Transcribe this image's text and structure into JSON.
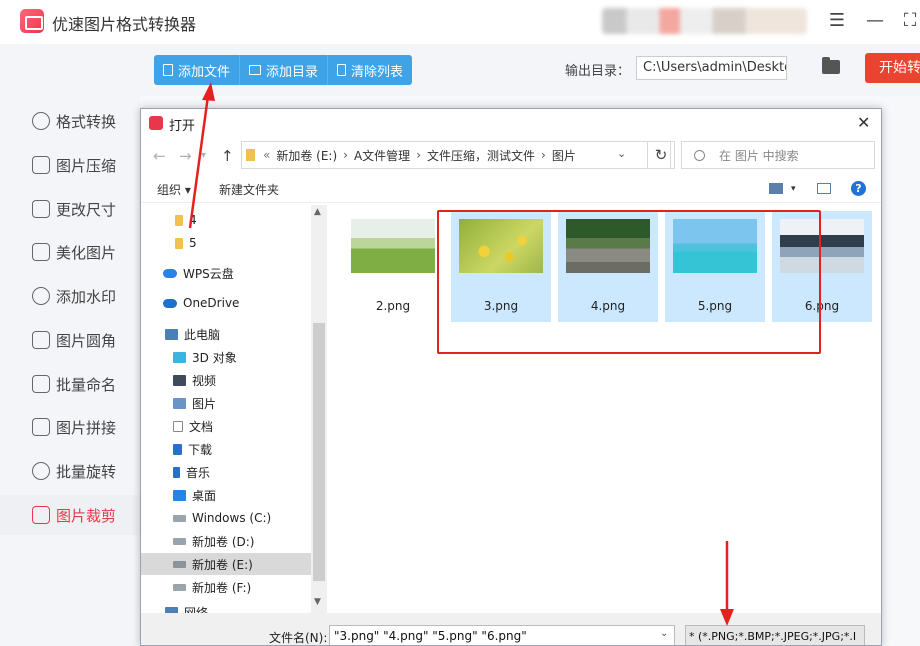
{
  "app": {
    "title": "优速图片格式转换器",
    "window_controls": {
      "menu": "☰",
      "minimize": "—",
      "maximize": "⛶"
    }
  },
  "sidebar": {
    "items": [
      {
        "label": "格式转换",
        "icon": "convert-icon"
      },
      {
        "label": "图片压缩",
        "icon": "compress-icon"
      },
      {
        "label": "更改尺寸",
        "icon": "resize-icon"
      },
      {
        "label": "美化图片",
        "icon": "beautify-icon"
      },
      {
        "label": "添加水印",
        "icon": "watermark-icon"
      },
      {
        "label": "图片圆角",
        "icon": "round-corner-icon"
      },
      {
        "label": "批量命名",
        "icon": "rename-icon"
      },
      {
        "label": "图片拼接",
        "icon": "stitch-icon"
      },
      {
        "label": "批量旋转",
        "icon": "rotate-icon"
      },
      {
        "label": "图片裁剪",
        "icon": "crop-icon",
        "active": true
      }
    ]
  },
  "toolbar": {
    "add_file": "添加文件",
    "add_dir": "添加目录",
    "clear_list": "清除列表",
    "output_label": "输出目录：",
    "output_path": "C:\\Users\\admin\\Deskto",
    "start": "开始转"
  },
  "dialog": {
    "title": "打开",
    "close": "✕",
    "breadcrumb": [
      "新加卷 (E:)",
      "A文件管理",
      "文件压缩，测试文件",
      "图片"
    ],
    "breadcrumb_prefix": "«",
    "search_placeholder": "在 图片 中搜索",
    "organize": "组织 ▾",
    "new_folder": "新建文件夹",
    "help": "?",
    "tree": [
      {
        "label": "4",
        "icon": "folder-icon"
      },
      {
        "label": "5",
        "icon": "folder-icon"
      },
      {
        "label": "WPS云盘",
        "icon": "cloud-icon"
      },
      {
        "label": "OneDrive",
        "icon": "cloud-icon"
      },
      {
        "label": "此电脑",
        "icon": "computer-icon"
      },
      {
        "label": "3D 对象",
        "icon": "3d-icon"
      },
      {
        "label": "视频",
        "icon": "video-icon"
      },
      {
        "label": "图片",
        "icon": "pictures-icon"
      },
      {
        "label": "文档",
        "icon": "documents-icon"
      },
      {
        "label": "下载",
        "icon": "download-icon"
      },
      {
        "label": "音乐",
        "icon": "music-icon"
      },
      {
        "label": "桌面",
        "icon": "desktop-icon"
      },
      {
        "label": "Windows (C:)",
        "icon": "drive-icon"
      },
      {
        "label": "新加卷 (D:)",
        "icon": "drive-icon"
      },
      {
        "label": "新加卷 (E:)",
        "icon": "drive-icon",
        "selected": true
      },
      {
        "label": "新加卷 (F:)",
        "icon": "drive-icon"
      },
      {
        "label": "网络",
        "icon": "network-icon"
      }
    ],
    "files": [
      {
        "name": "2.png",
        "selected": false
      },
      {
        "name": "3.png",
        "selected": true
      },
      {
        "name": "4.png",
        "selected": true
      },
      {
        "name": "5.png",
        "selected": true
      },
      {
        "name": "6.png",
        "selected": true
      }
    ],
    "filename_label": "文件名(N):",
    "filename_value": "\"3.png\" \"4.png\" \"5.png\" \"6.png\"",
    "filetype_value": "* (*.PNG;*.BMP;*.JPEG;*.JPG;*.I"
  },
  "colors": {
    "accent_blue": "#3fa3e8",
    "accent_red": "#e8364b",
    "start_button": "#e8442f",
    "annotation_red": "#e3211f",
    "selection_blue": "#cce8ff"
  }
}
